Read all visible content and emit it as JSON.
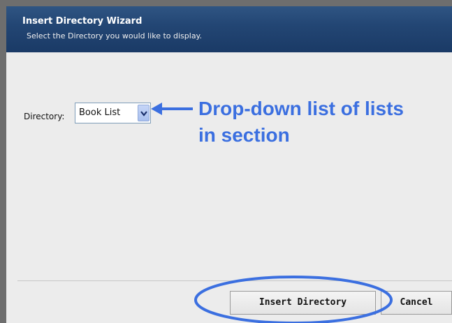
{
  "dialog": {
    "title": "Insert Directory Wizard",
    "subtitle": "Select the Directory you would like to display."
  },
  "form": {
    "directory_label": "Directory:",
    "directory_selected": "Book List"
  },
  "annotation": {
    "text": "Drop-down list of lists in section",
    "color": "#3b6fe0"
  },
  "buttons": {
    "insert_label": "Insert Directory",
    "cancel_label": "Cancel"
  },
  "colors": {
    "header": "#1f4170",
    "annotation": "#3b6fe0"
  },
  "icons": {
    "dropdown": "chevron-down-icon",
    "annotation_arrow": "arrow-left-icon"
  }
}
